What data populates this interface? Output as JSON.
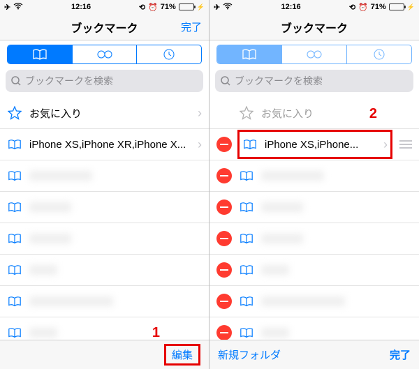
{
  "status": {
    "time": "12:16",
    "battery_pct": "71%"
  },
  "left": {
    "title": "ブックマーク",
    "done": "完了",
    "search_placeholder": "ブックマークを検索",
    "favorites": "お気に入り",
    "bookmark0": "iPhone XS,iPhone XR,iPhone X...",
    "toolbar_edit": "編集",
    "callout": "1"
  },
  "right": {
    "title": "ブックマーク",
    "search_placeholder": "ブックマークを検索",
    "favorites": "お気に入り",
    "bookmark0": "iPhone XS,iPhone...",
    "toolbar_newfolder": "新規フォルダ",
    "toolbar_done": "完了",
    "callout": "2"
  }
}
